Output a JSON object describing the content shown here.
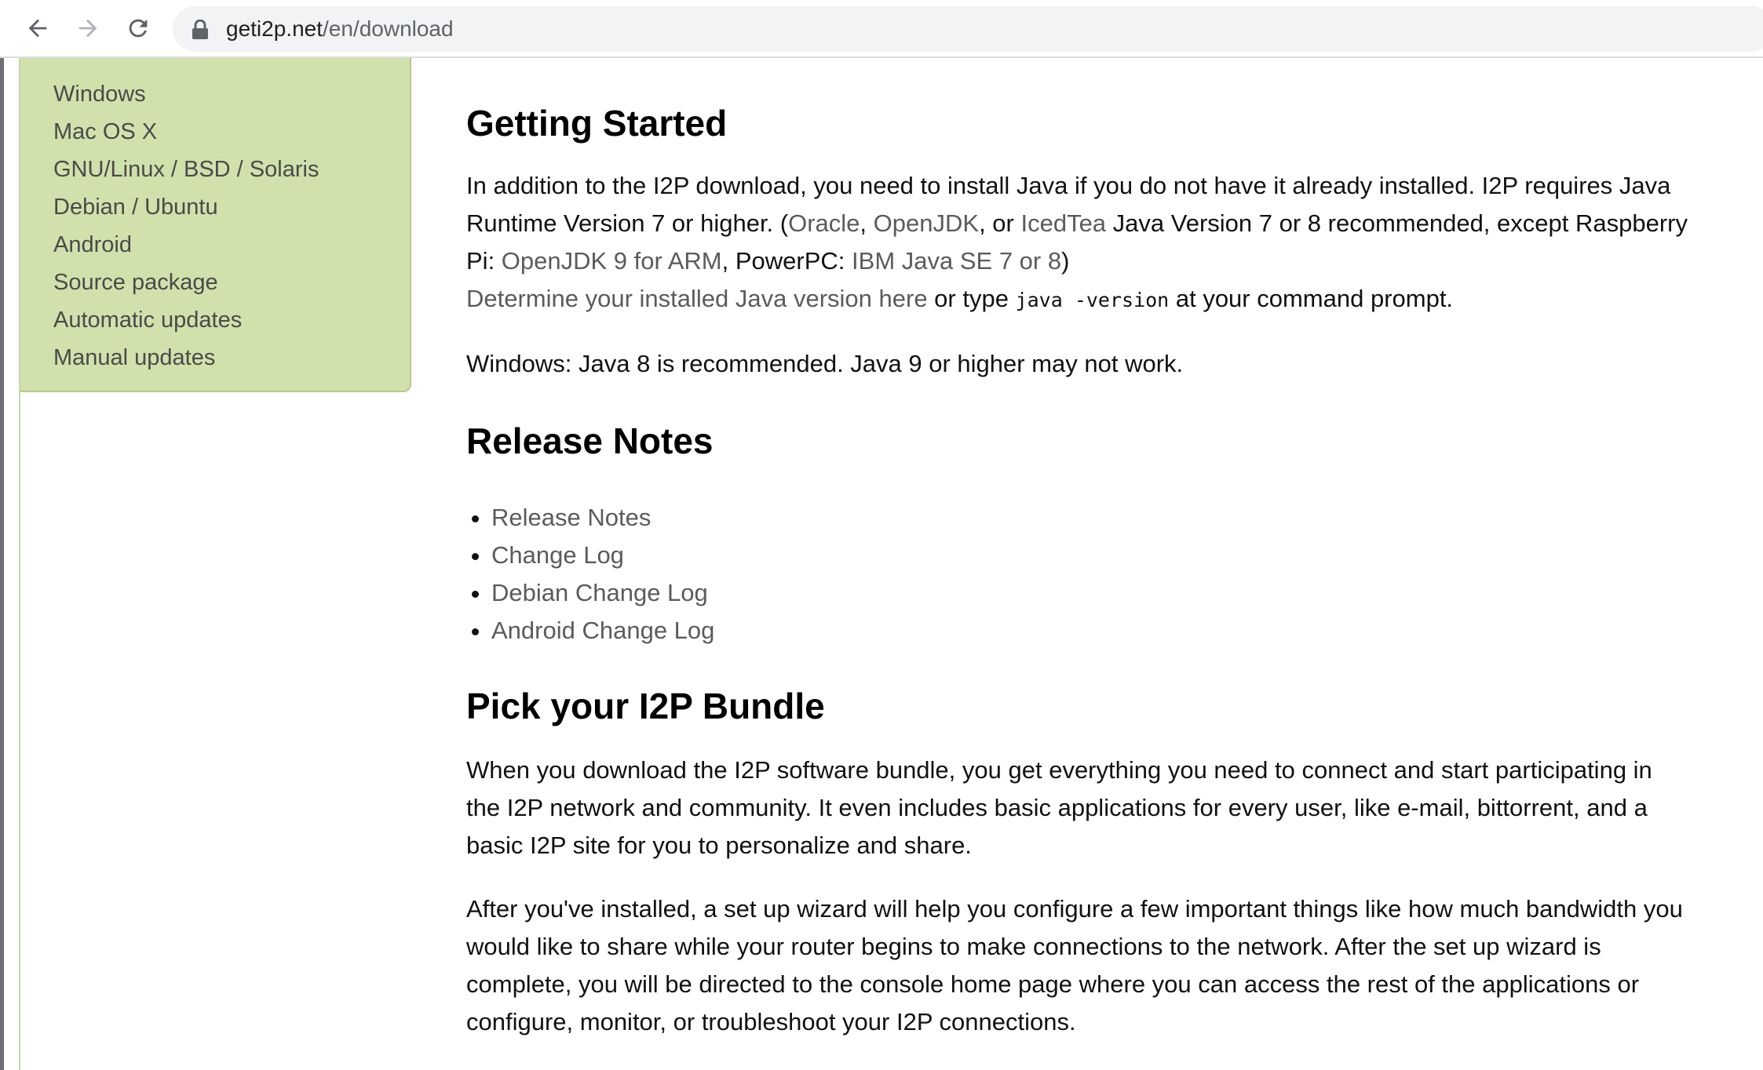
{
  "browser": {
    "url_host": "geti2p.net",
    "url_path": "/en/download"
  },
  "sidebar": {
    "items": [
      {
        "label": "Windows"
      },
      {
        "label": "Mac OS X"
      },
      {
        "label": "GNU/Linux / BSD / Solaris"
      },
      {
        "label": "Debian / Ubuntu"
      },
      {
        "label": "Android"
      },
      {
        "label": "Source package"
      },
      {
        "label": "Automatic updates"
      },
      {
        "label": "Manual updates"
      }
    ]
  },
  "getting_started": {
    "heading": "Getting Started",
    "p1_a": "In addition to the I2P download, you need to install Java if you do not have it already installed. I2P requires Java Runtime Version 7 or higher. (",
    "link_oracle": "Oracle",
    "p1_b": ", ",
    "link_openjdk": "OpenJDK",
    "p1_c": ", or ",
    "link_icedtea": "IcedTea",
    "p1_d": " Java Version 7 or 8 recommended, except Raspberry Pi: ",
    "link_openjdk9_arm": "OpenJDK 9 for ARM",
    "p1_e": ", PowerPC: ",
    "link_ibm_java": "IBM Java SE 7 or 8",
    "p1_f": ")",
    "link_determine_java": "Determine your installed Java version here",
    "p2_a": " or type ",
    "code_java_version": "java -version",
    "p2_b": " at your command prompt.",
    "windows_note": "Windows: Java 8 is recommended. Java 9 or higher may not work."
  },
  "release_notes": {
    "heading": "Release Notes",
    "links": [
      {
        "label": "Release Notes"
      },
      {
        "label": "Change Log"
      },
      {
        "label": "Debian Change Log"
      },
      {
        "label": "Android Change Log"
      }
    ]
  },
  "bundle": {
    "heading": "Pick your I2P Bundle",
    "p1": "When you download the I2P software bundle, you get everything you need to connect and start participating in the I2P network and community. It even includes basic applications for every user, like e-mail, bittorrent, and a basic I2P site for you to personalize and share.",
    "p2": "After you've installed, a set up wizard will help you configure a few important things like how much bandwidth you would like to share while your router begins to make connections to the network. After the set up wizard is complete, you will be directed to the console home page where you can access the rest of the applications or configure, monitor, or troubleshoot your I2P connections."
  }
}
